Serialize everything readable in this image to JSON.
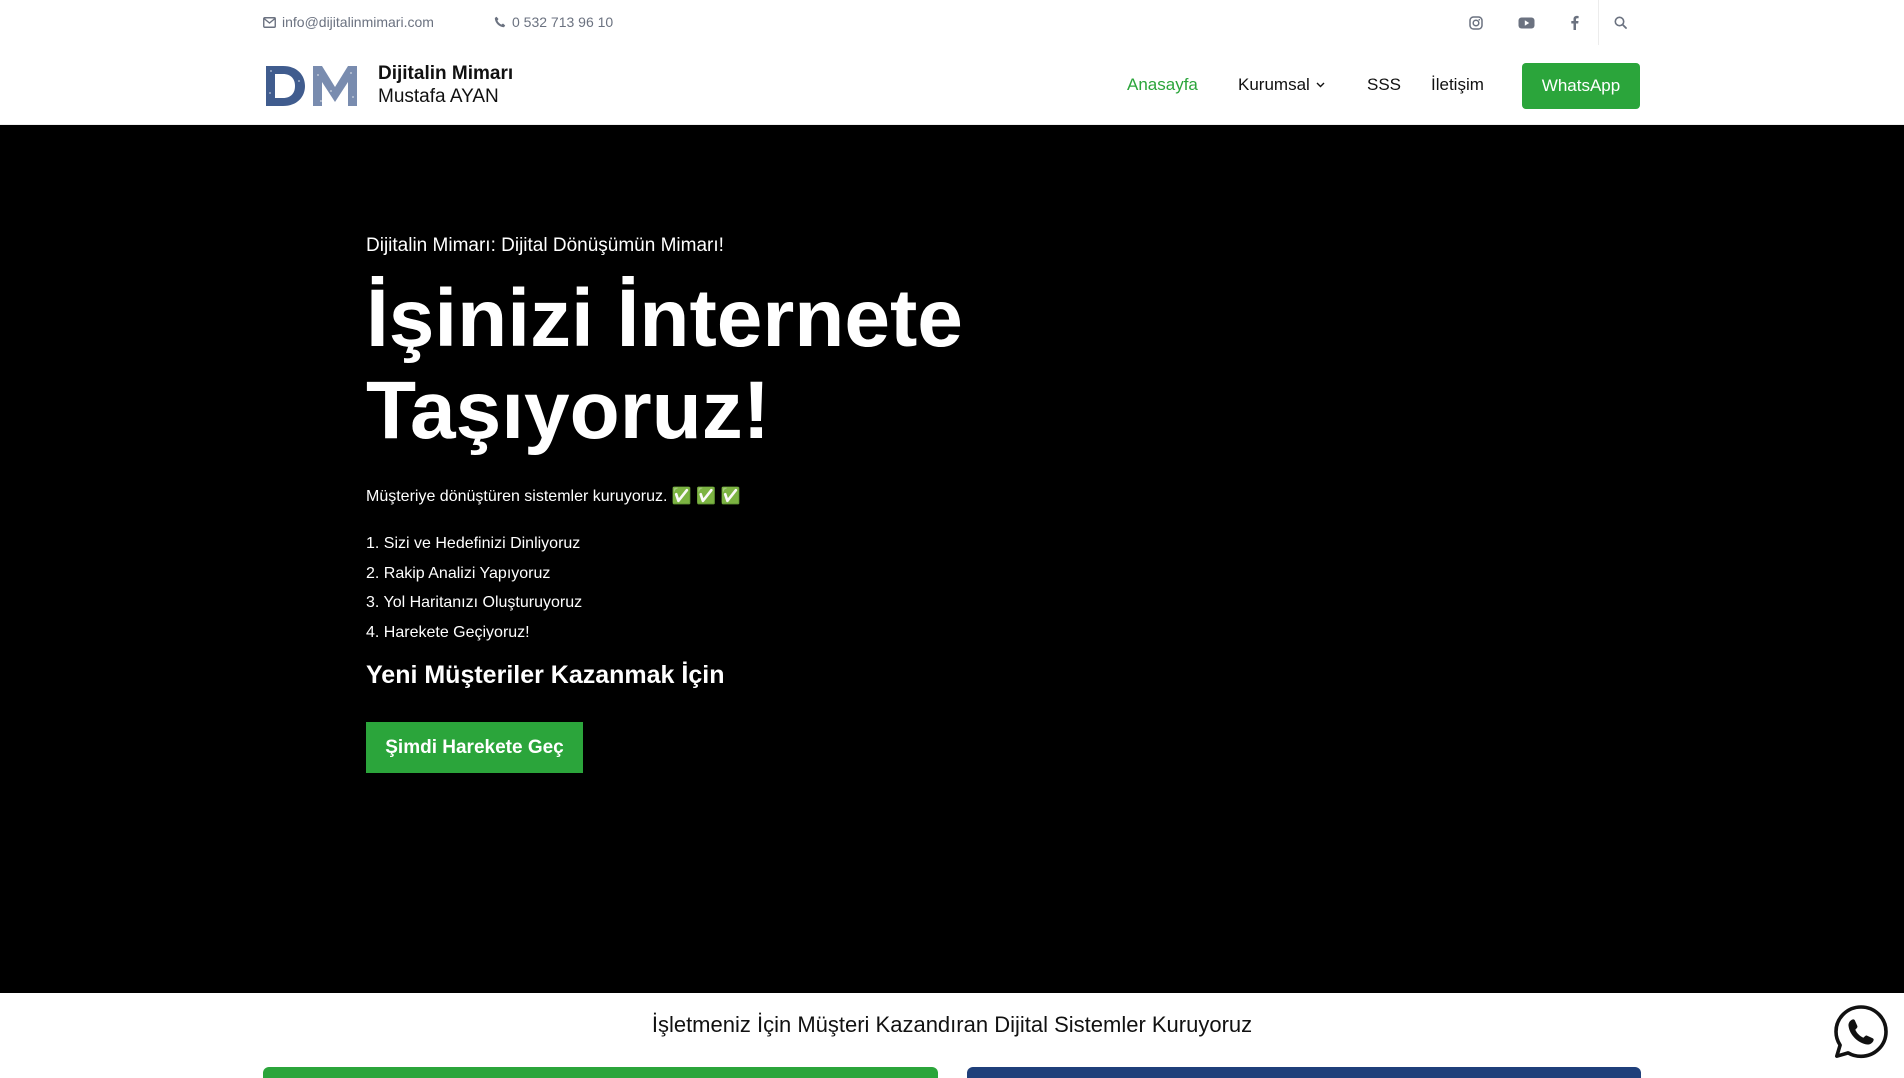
{
  "topbar": {
    "email": "info@dijitalinmimari.com",
    "phone": "0 532 713 96 10"
  },
  "brand": {
    "title": "Dijitalin Mimarı",
    "subtitle": "Mustafa AYAN",
    "mark_color": "#1f3f7a"
  },
  "nav": {
    "home": "Anasayfa",
    "corporate": "Kurumsal",
    "faq": "SSS",
    "contact": "İletişim",
    "whatsapp": "WhatsApp"
  },
  "hero": {
    "kicker": "Dijitalin Mimarı: Dijital Dönüşümün Mimarı!",
    "headline": "İşinizi İnternete Taşıyoruz!",
    "lead": "Müşteriye dönüştüren sistemler kuruyoruz. ✅ ✅ ✅",
    "steps": [
      "1. Sizi ve Hedefinizi Dinliyoruz",
      "2. Rakip Analizi Yapıyoruz",
      "3. Yol Haritanızı Oluşturuyoruz",
      "4. Harekete Geçiyoruz!"
    ],
    "sub_heading": "Yeni Müşteriler Kazanmak İçin",
    "cta": "Şimdi Harekete Geç"
  },
  "section": {
    "title": "İşletmeniz İçin Müşteri Kazandıran Dijital Sistemler Kuruyoruz"
  },
  "colors": {
    "accent": "#2ba53b",
    "dark_blue": "#1f3f7a",
    "hero_bg": "#000000"
  },
  "icons": {
    "email": "envelope-icon",
    "phone": "phone-icon",
    "instagram": "instagram-icon",
    "youtube": "youtube-icon",
    "facebook": "facebook-icon",
    "search": "search-icon",
    "dropdown": "chevron-down-icon",
    "float": "whatsapp-icon"
  }
}
